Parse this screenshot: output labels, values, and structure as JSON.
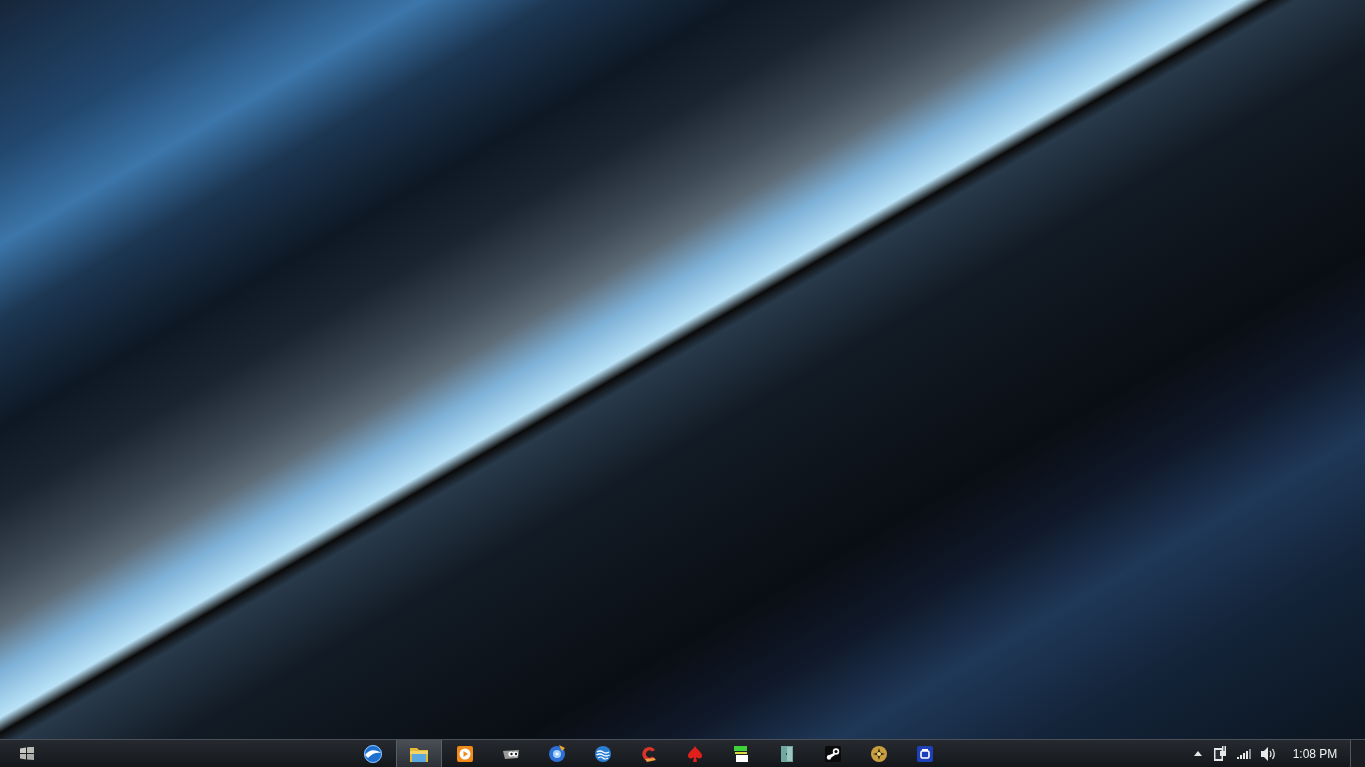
{
  "taskbar": {
    "apps": [
      {
        "active": false
      },
      {
        "active": true
      },
      {
        "active": false
      },
      {
        "active": false
      },
      {
        "active": false
      },
      {
        "active": false
      },
      {
        "active": false
      },
      {
        "active": false
      },
      {
        "active": false
      },
      {
        "active": false
      },
      {
        "active": false
      },
      {
        "active": false
      },
      {
        "active": false
      }
    ],
    "clock": "1:08 PM"
  }
}
